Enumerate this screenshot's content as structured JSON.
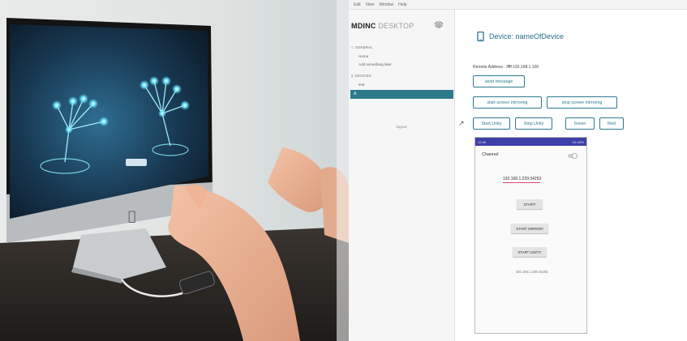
{
  "menubar": {
    "items": [
      "Edit",
      "View",
      "Window",
      "Help"
    ]
  },
  "app": {
    "name_bold": "MDINC",
    "name_light": "DESKTOP"
  },
  "sidebar": {
    "groups": [
      {
        "label": "GENERAL",
        "items": [
          "Home",
          "Add something later"
        ]
      },
      {
        "label": "DEVICES",
        "items": [
          "test",
          "A"
        ]
      }
    ],
    "selected_index": 1,
    "logout_label": "logout"
  },
  "device": {
    "title": "Device: nameOfDevice",
    "remote_address": "Remote Address : /ffff:192.168.1.100"
  },
  "buttons": {
    "send_message": "send message",
    "start_mirroring": "start screen mirroring",
    "stop_mirroring": "stop screen mirroring",
    "start_unity": "Start Unity",
    "stop_unity": "Stop Unity",
    "green": "Green",
    "red": "Red"
  },
  "phone": {
    "status_left": "12:46",
    "status_right": "4G 46%",
    "channel_label": "Channel",
    "ip_value": "192.168.1.239:34263",
    "start": "START!",
    "start_mirror": "START MIRROR!",
    "start_unity": "START UNITY!",
    "ip_status": "192.168.1.239:34263"
  },
  "colors": {
    "accent": "#2d7a8c",
    "phone_statusbar": "#3f3fa8",
    "field_underline": "#e0457a"
  }
}
